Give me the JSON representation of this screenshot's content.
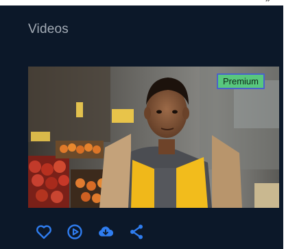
{
  "card": {
    "title": "Videos"
  },
  "video": {
    "badge": "Premium",
    "thumbnail": "boy-at-market-stall"
  },
  "actions": [
    {
      "name": "like",
      "icon": "heart-icon"
    },
    {
      "name": "play",
      "icon": "play-circle-icon"
    },
    {
      "name": "download",
      "icon": "cloud-download-icon"
    },
    {
      "name": "share",
      "icon": "share-icon"
    }
  ],
  "colors": {
    "background": "#0c1829",
    "title": "#a4acb6",
    "accent": "#2f7df0",
    "badge_bg": "#58c77e",
    "badge_border": "#4a62c8"
  }
}
